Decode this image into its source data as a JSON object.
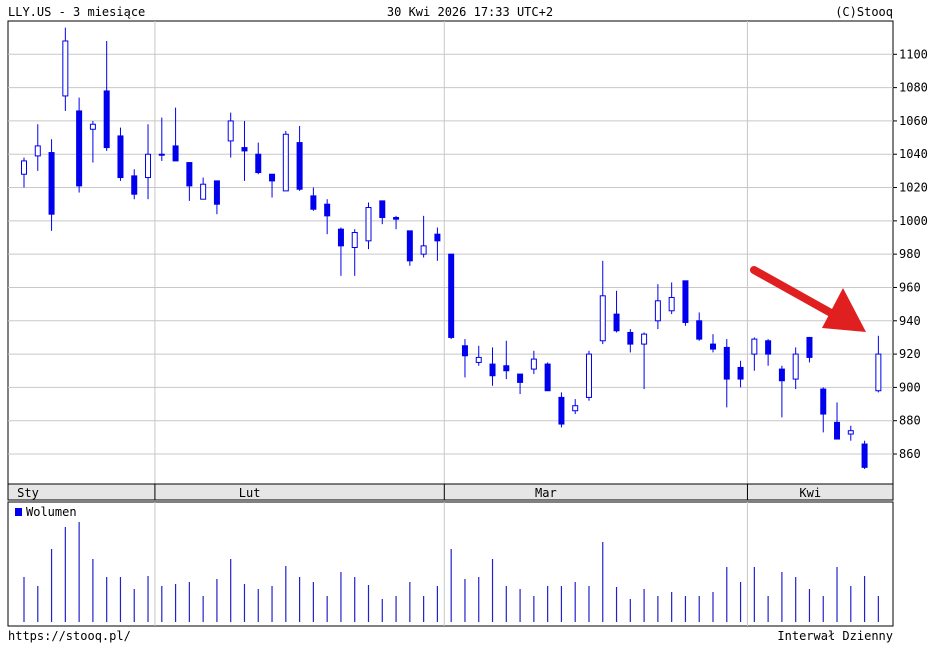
{
  "header": {
    "left": "LLY.US - 3 miesiące",
    "center": "30 Kwi 2026 17:33 UTC+2",
    "right": "(C)Stooq"
  },
  "footer": {
    "left": "https://stooq.pl/",
    "right": "Interwał Dzienny"
  },
  "colors": {
    "candle": "#0000ee",
    "volume": "#2222cc",
    "arrow": "#e02020",
    "grid": "#c8c8c8"
  },
  "chart_data": {
    "type": "candlestick",
    "ylim": [
      842,
      1120
    ],
    "y_ticks": [
      860,
      880,
      900,
      920,
      940,
      960,
      980,
      1000,
      1020,
      1040,
      1060,
      1080,
      1100
    ],
    "months": [
      "Sty",
      "Lut",
      "Mar",
      "Kwi"
    ],
    "month_start_index": [
      0,
      10,
      31,
      53
    ],
    "volume_legend": "Wolumen",
    "annotation": "red arrow pointing to last candle",
    "candles": [
      {
        "o": 1028,
        "h": 1038,
        "l": 1020,
        "c": 1036,
        "v": 0.45
      },
      {
        "o": 1039,
        "h": 1058,
        "l": 1030,
        "c": 1045,
        "v": 0.36
      },
      {
        "o": 1041,
        "h": 1049,
        "l": 994,
        "c": 1004,
        "v": 0.73
      },
      {
        "o": 1075,
        "h": 1116,
        "l": 1066,
        "c": 1108,
        "v": 0.95
      },
      {
        "o": 1066,
        "h": 1074,
        "l": 1017,
        "c": 1021,
        "v": 1.0
      },
      {
        "o": 1055,
        "h": 1060,
        "l": 1035,
        "c": 1058,
        "v": 0.63
      },
      {
        "o": 1078,
        "h": 1108,
        "l": 1042,
        "c": 1044,
        "v": 0.45
      },
      {
        "o": 1051,
        "h": 1056,
        "l": 1024,
        "c": 1026,
        "v": 0.45
      },
      {
        "o": 1027,
        "h": 1031,
        "l": 1013,
        "c": 1016,
        "v": 0.33
      },
      {
        "o": 1026,
        "h": 1058,
        "l": 1013,
        "c": 1040,
        "v": 0.46
      },
      {
        "o": 1040,
        "h": 1062,
        "l": 1036,
        "c": 1040,
        "v": 0.36
      },
      {
        "o": 1045,
        "h": 1068,
        "l": 1036,
        "c": 1036,
        "v": 0.38
      },
      {
        "o": 1035,
        "h": 1033,
        "l": 1012,
        "c": 1021,
        "v": 0.4
      },
      {
        "o": 1013,
        "h": 1026,
        "l": 1014,
        "c": 1022,
        "v": 0.26
      },
      {
        "o": 1024,
        "h": 1024,
        "l": 1004,
        "c": 1010,
        "v": 0.43
      },
      {
        "o": 1048,
        "h": 1065,
        "l": 1038,
        "c": 1060,
        "v": 0.63
      },
      {
        "o": 1044,
        "h": 1060,
        "l": 1024,
        "c": 1042,
        "v": 0.38
      },
      {
        "o": 1040,
        "h": 1047,
        "l": 1028,
        "c": 1029,
        "v": 0.33
      },
      {
        "o": 1028,
        "h": 1028,
        "l": 1014,
        "c": 1024,
        "v": 0.36
      },
      {
        "o": 1018,
        "h": 1054,
        "l": 1018,
        "c": 1052,
        "v": 0.56
      },
      {
        "o": 1047,
        "h": 1057,
        "l": 1018,
        "c": 1019,
        "v": 0.45
      },
      {
        "o": 1015,
        "h": 1020,
        "l": 1006,
        "c": 1007,
        "v": 0.4
      },
      {
        "o": 1010,
        "h": 1013,
        "l": 992,
        "c": 1003,
        "v": 0.26
      },
      {
        "o": 995,
        "h": 996,
        "l": 967,
        "c": 985,
        "v": 0.5
      },
      {
        "o": 984,
        "h": 995,
        "l": 967,
        "c": 993,
        "v": 0.45
      },
      {
        "o": 988,
        "h": 1011,
        "l": 983,
        "c": 1008,
        "v": 0.37
      },
      {
        "o": 1012,
        "h": 1011,
        "l": 998,
        "c": 1002,
        "v": 0.23
      },
      {
        "o": 1002,
        "h": 1003,
        "l": 995,
        "c": 1001,
        "v": 0.26
      },
      {
        "o": 994,
        "h": 992,
        "l": 973,
        "c": 976,
        "v": 0.4
      },
      {
        "o": 980,
        "h": 1003,
        "l": 978,
        "c": 985,
        "v": 0.26
      },
      {
        "o": 992,
        "h": 996,
        "l": 976,
        "c": 988,
        "v": 0.36
      },
      {
        "o": 980,
        "h": 980,
        "l": 929,
        "c": 930,
        "v": 0.73
      },
      {
        "o": 925,
        "h": 929,
        "l": 906,
        "c": 919,
        "v": 0.43
      },
      {
        "o": 915,
        "h": 925,
        "l": 913,
        "c": 918,
        "v": 0.45
      },
      {
        "o": 914,
        "h": 924,
        "l": 901,
        "c": 907,
        "v": 0.63
      },
      {
        "o": 913,
        "h": 928,
        "l": 905,
        "c": 910,
        "v": 0.36
      },
      {
        "o": 908,
        "h": 907,
        "l": 896,
        "c": 903,
        "v": 0.33
      },
      {
        "o": 911,
        "h": 922,
        "l": 908,
        "c": 917,
        "v": 0.26
      },
      {
        "o": 914,
        "h": 915,
        "l": 898,
        "c": 898,
        "v": 0.36
      },
      {
        "o": 894,
        "h": 897,
        "l": 876,
        "c": 878,
        "v": 0.36
      },
      {
        "o": 886,
        "h": 893,
        "l": 884,
        "c": 889,
        "v": 0.4
      },
      {
        "o": 894,
        "h": 922,
        "l": 892,
        "c": 920,
        "v": 0.36
      },
      {
        "o": 928,
        "h": 976,
        "l": 926,
        "c": 955,
        "v": 0.8
      },
      {
        "o": 944,
        "h": 958,
        "l": 933,
        "c": 934,
        "v": 0.35
      },
      {
        "o": 933,
        "h": 935,
        "l": 921,
        "c": 926,
        "v": 0.23
      },
      {
        "o": 926,
        "h": 933,
        "l": 899,
        "c": 932,
        "v": 0.33
      },
      {
        "o": 940,
        "h": 962,
        "l": 935,
        "c": 952,
        "v": 0.26
      },
      {
        "o": 946,
        "h": 963,
        "l": 944,
        "c": 954,
        "v": 0.3
      },
      {
        "o": 964,
        "h": 964,
        "l": 937,
        "c": 939,
        "v": 0.26
      },
      {
        "o": 940,
        "h": 945,
        "l": 928,
        "c": 929,
        "v": 0.26
      },
      {
        "o": 926,
        "h": 932,
        "l": 921,
        "c": 923,
        "v": 0.3
      },
      {
        "o": 924,
        "h": 929,
        "l": 888,
        "c": 905,
        "v": 0.55
      },
      {
        "o": 912,
        "h": 916,
        "l": 900,
        "c": 905,
        "v": 0.4
      },
      {
        "o": 920,
        "h": 930,
        "l": 910,
        "c": 929,
        "v": 0.55
      },
      {
        "o": 928,
        "h": 929,
        "l": 913,
        "c": 920,
        "v": 0.26
      },
      {
        "o": 911,
        "h": 913,
        "l": 882,
        "c": 904,
        "v": 0.5
      },
      {
        "o": 905,
        "h": 924,
        "l": 899,
        "c": 920,
        "v": 0.45
      },
      {
        "o": 930,
        "h": 929,
        "l": 915,
        "c": 918,
        "v": 0.33
      },
      {
        "o": 899,
        "h": 900,
        "l": 873,
        "c": 884,
        "v": 0.26
      },
      {
        "o": 879,
        "h": 891,
        "l": 869,
        "c": 869,
        "v": 0.55
      },
      {
        "o": 872,
        "h": 877,
        "l": 868,
        "c": 874,
        "v": 0.36
      },
      {
        "o": 866,
        "h": 868,
        "l": 851,
        "c": 852,
        "v": 0.46
      },
      {
        "o": 898,
        "h": 931,
        "l": 897,
        "c": 920,
        "v": 0.26
      }
    ]
  }
}
